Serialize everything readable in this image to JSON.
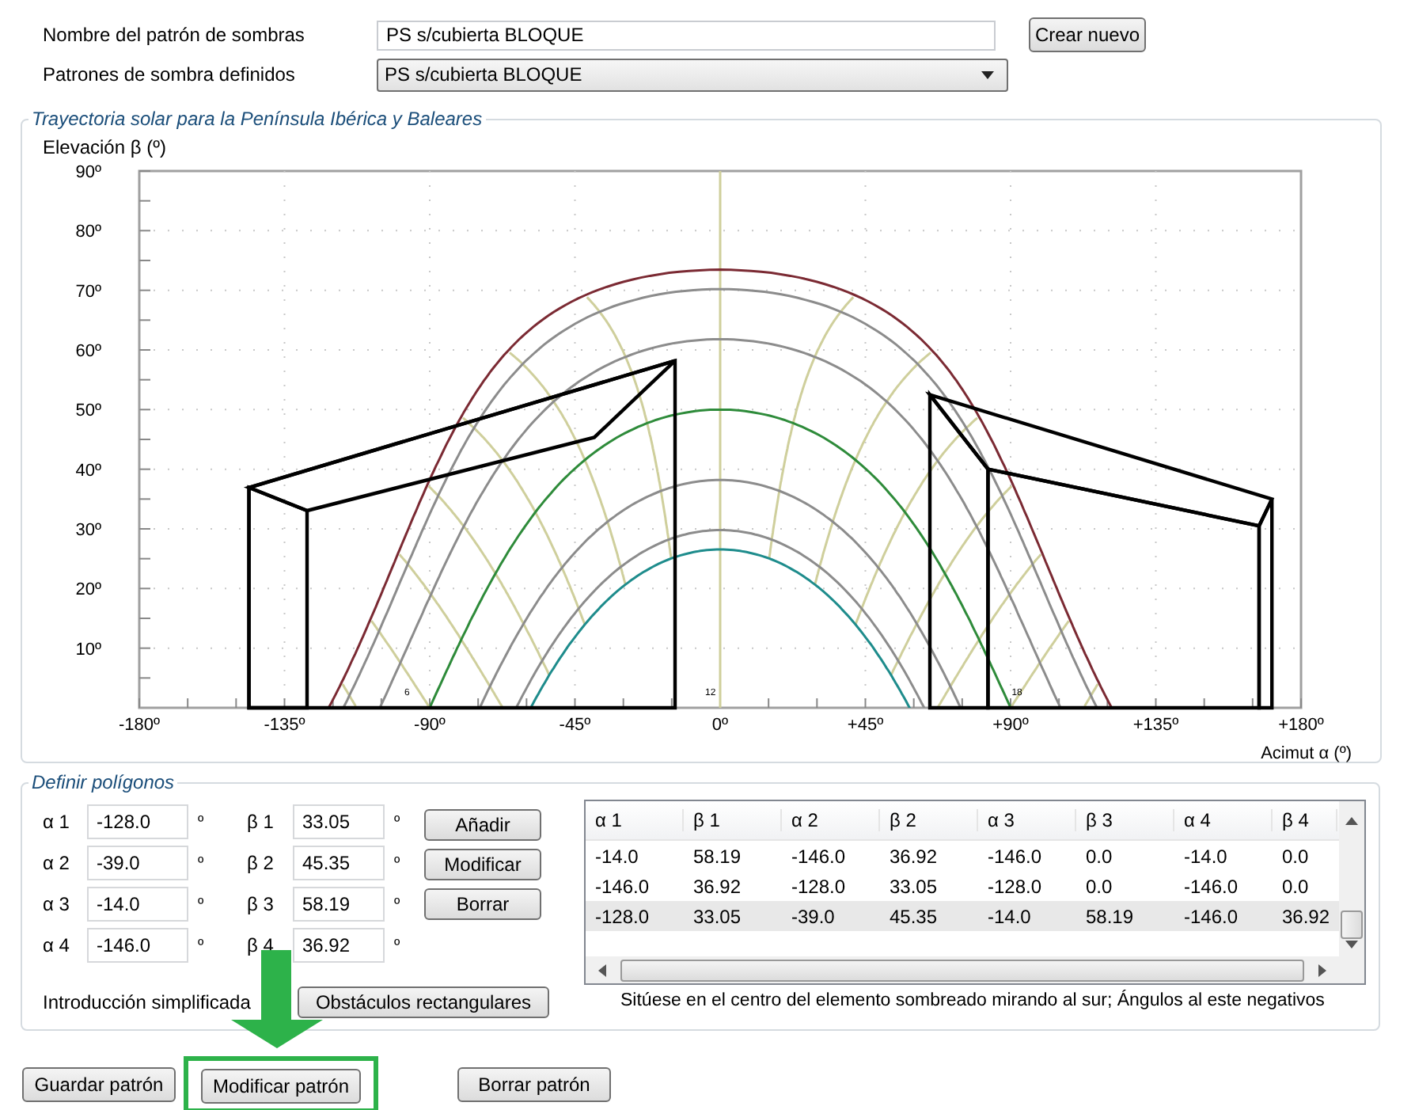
{
  "header": {
    "name_label": "Nombre del patrón de sombras",
    "name_value": "PS s/cubierta BLOQUE",
    "create_button": "Crear nuevo",
    "patterns_label": "Patrones de sombra definidos",
    "patterns_value": "PS s/cubierta BLOQUE"
  },
  "chart_panel": {
    "title": "Trayectoria solar para la Península Ibérica y Baleares",
    "y_title": "Elevación β (º)",
    "x_title": "Acimut α (º)",
    "y_ticks": [
      "90º",
      "80º",
      "70º",
      "60º",
      "50º",
      "40º",
      "30º",
      "20º",
      "10º"
    ],
    "x_ticks": [
      "-180º",
      "-135º",
      "-90º",
      "-45º",
      "0º",
      "+45º",
      "+90º",
      "+135º",
      "+180º"
    ],
    "hour_labels": [
      "6",
      "12",
      "18"
    ]
  },
  "polygon_panel": {
    "title": "Definir polígonos",
    "fields": [
      {
        "alpha_label": "α 1",
        "alpha_value": "-128.0",
        "alpha_unit": "º",
        "beta_label": "β 1",
        "beta_value": "33.05",
        "beta_unit": "º"
      },
      {
        "alpha_label": "α 2",
        "alpha_value": "-39.0",
        "alpha_unit": "º",
        "beta_label": "β 2",
        "beta_value": "45.35",
        "beta_unit": "º"
      },
      {
        "alpha_label": "α 3",
        "alpha_value": "-14.0",
        "alpha_unit": "º",
        "beta_label": "β 3",
        "beta_value": "58.19",
        "beta_unit": "º"
      },
      {
        "alpha_label": "α 4",
        "alpha_value": "-146.0",
        "alpha_unit": "º",
        "beta_label": "β 4",
        "beta_value": "36.92",
        "beta_unit": "º"
      }
    ],
    "buttons": [
      "Añadir",
      "Modificar",
      "Borrar"
    ],
    "simplified_label": "Introducción simplificada",
    "simplified_button": "Obstáculos rectangulares",
    "table": {
      "columns": [
        "α 1",
        "β 1",
        "α 2",
        "β 2",
        "α 3",
        "β 3",
        "α 4",
        "β 4"
      ],
      "rows": [
        {
          "selected": false,
          "cells": [
            "-14.0",
            "58.19",
            "-146.0",
            "36.92",
            "-146.0",
            "0.0",
            "-14.0",
            "0.0"
          ]
        },
        {
          "selected": false,
          "cells": [
            "-146.0",
            "36.92",
            "-128.0",
            "33.05",
            "-128.0",
            "0.0",
            "-146.0",
            "0.0"
          ]
        },
        {
          "selected": true,
          "cells": [
            "-128.0",
            "33.05",
            "-39.0",
            "45.35",
            "-14.0",
            "58.19",
            "-146.0",
            "36.92"
          ]
        }
      ]
    },
    "caption": "Sitúese en el centro del elemento sombreado mirando al sur; Ángulos al este negativos"
  },
  "footer_buttons": [
    "Guardar patrón",
    "Modificar patrón",
    "Borrar patrón"
  ]
}
